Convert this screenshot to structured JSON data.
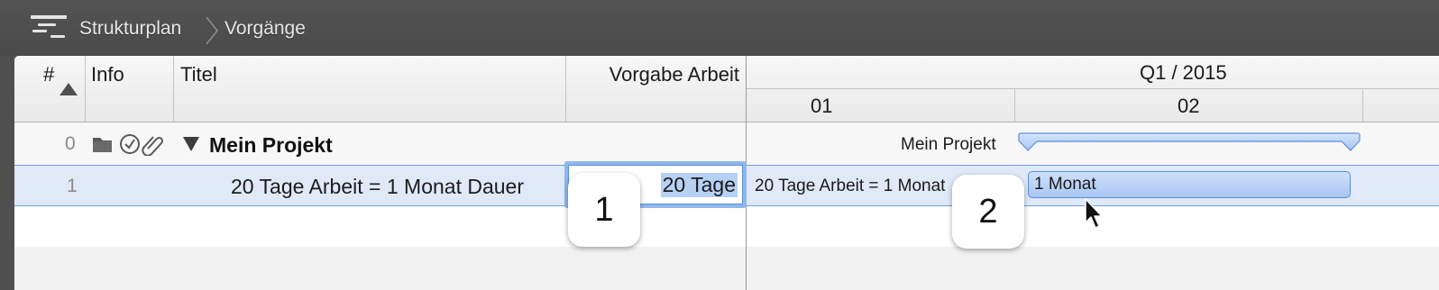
{
  "breadcrumb": {
    "items": [
      "Strukturplan",
      "Vorgänge"
    ],
    "icon": "structure-plan-icon"
  },
  "table": {
    "columns": {
      "number": "#",
      "info": "Info",
      "title": "Titel",
      "work": "Vorgabe Arbeit"
    },
    "rows": [
      {
        "number": "0",
        "title": "Mein Projekt",
        "type": "summary",
        "expanded": true,
        "info_icons": [
          "folder-icon",
          "checkmark-circle-icon",
          "paperclip-icon"
        ]
      },
      {
        "number": "1",
        "title": "20 Tage Arbeit = 1 Monat Dauer",
        "work": "20 Tage",
        "selected": true
      }
    ]
  },
  "gantt": {
    "quarter": "Q1 / 2015",
    "weeks": [
      "01",
      "02"
    ],
    "summary_label": "Mein Projekt",
    "task_label": "20 Tage Arbeit = 1 Monat",
    "task_bar_label": "1 Monat"
  },
  "callouts": [
    "1",
    "2"
  ],
  "colors": {
    "selection": "#dfe9f8",
    "selection_border": "#6f9fdc",
    "bar": "#a9c6f3",
    "toolbar": "#4f4f4f"
  }
}
